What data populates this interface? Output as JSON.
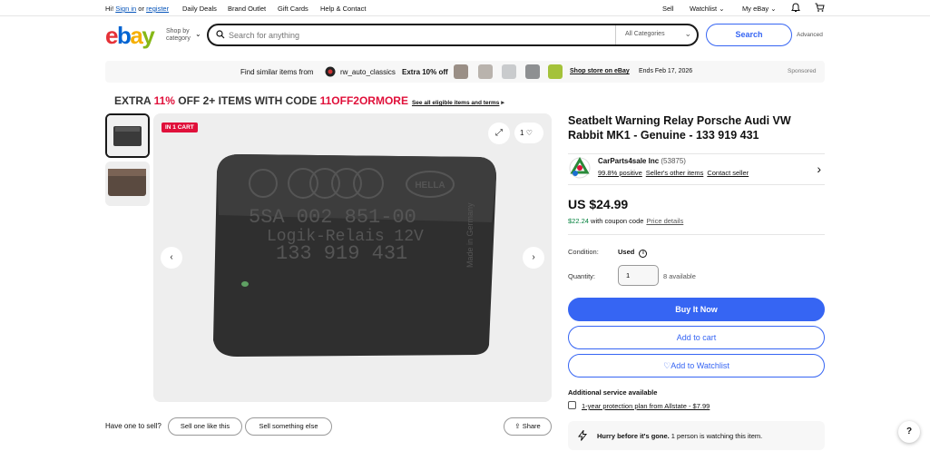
{
  "topnav": {
    "greeting": "Hi!",
    "sign_in": "Sign in",
    "or": "or",
    "register": "register",
    "links": [
      "Daily Deals",
      "Brand Outlet",
      "Gift Cards",
      "Help & Contact"
    ],
    "sell": "Sell",
    "watchlist": "Watchlist",
    "my_ebay": "My eBay"
  },
  "header": {
    "logo": [
      "e",
      "b",
      "a",
      "y"
    ],
    "shop_by_line1": "Shop by",
    "shop_by_line2": "category",
    "search_placeholder": "Search for anything",
    "category": "All Categories",
    "search_button": "Search",
    "advanced": "Advanced"
  },
  "banner": {
    "prefix": "Find similar items from",
    "store": "rw_auto_classics",
    "discount": "Extra 10% off",
    "shop_link": "Shop store on eBay",
    "ends": "Ends Feb 17, 2026",
    "sponsored": "Sponsored"
  },
  "promo": {
    "part1": "EXTRA ",
    "percent": "11%",
    "part2": " OFF 2+ ITEMS WITH CODE ",
    "code": "11OFF2ORMORE",
    "link": "See all eligible items and terms"
  },
  "gallery": {
    "badge": "IN 1 CART",
    "watch_count": "1",
    "relay_text": [
      "5SA 002 851-00",
      "Logik-Relais 12V",
      "133 919 431"
    ],
    "side_text": "Made in Germany",
    "hella": "HELLA"
  },
  "below_gallery": {
    "prompt": "Have one to sell?",
    "sell_one": "Sell one like this",
    "sell_else": "Sell something else",
    "share": "Share"
  },
  "item": {
    "title": "Seatbelt Warning Relay Porsche Audi VW Rabbit MK1 - Genuine - 133 919 431",
    "seller_name": "CarParts4sale Inc",
    "seller_count": "(53875)",
    "positive": "99.8% positive",
    "other_items": "Seller's other items",
    "contact": "Contact seller",
    "price": "US $24.99",
    "coupon_price": "$22.24",
    "coupon_text": "with coupon code",
    "price_details": "Price details",
    "condition_label": "Condition:",
    "condition_value": "Used",
    "quantity_label": "Quantity:",
    "quantity_value": "1",
    "available": "8 available",
    "buy_now": "Buy It Now",
    "add_cart": "Add to cart",
    "add_watch": "Add to Watchlist",
    "additional_service": "Additional service available",
    "protection": "1-year protection plan from Allstate - $7.99",
    "hurry_bold": "Hurry before it's gone.",
    "hurry_rest": " 1 person is watching this item."
  },
  "colors": {
    "accent": "#3665f3",
    "badge": "#e0103a",
    "coupon_green": "#05823f"
  }
}
